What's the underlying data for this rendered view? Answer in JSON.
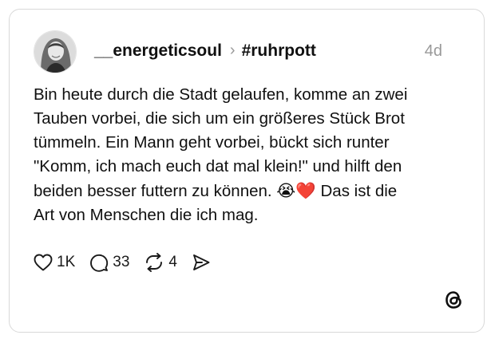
{
  "post": {
    "username": "__energeticsoul",
    "separator": "›",
    "topic": "#ruhrpott",
    "time": "4d",
    "text_lines": [
      "Bin heute durch die Stadt gelaufen, komme an zwei",
      "Tauben vorbei, die sich um ein größeres Stück Brot",
      "tümmeln. Ein Mann geht vorbei, bückt sich runter",
      "\"Komm, ich mach euch dat mal klein!\" und hilft den",
      "beiden besser futtern zu können.",
      "Das ist die",
      "Art von Menschen die ich mag."
    ],
    "emojis": "😭❤️"
  },
  "actions": {
    "like_icon": "heart-icon",
    "like_count": "1K",
    "reply_icon": "comment-icon",
    "reply_count": "33",
    "repost_icon": "repost-icon",
    "repost_count": "4",
    "share_icon": "share-icon"
  },
  "brand": {
    "logo_icon": "threads-logo-icon"
  },
  "colors": {
    "text": "#101010",
    "muted": "#999999",
    "border": "#d9d9d9",
    "heart": "#e0245e"
  }
}
